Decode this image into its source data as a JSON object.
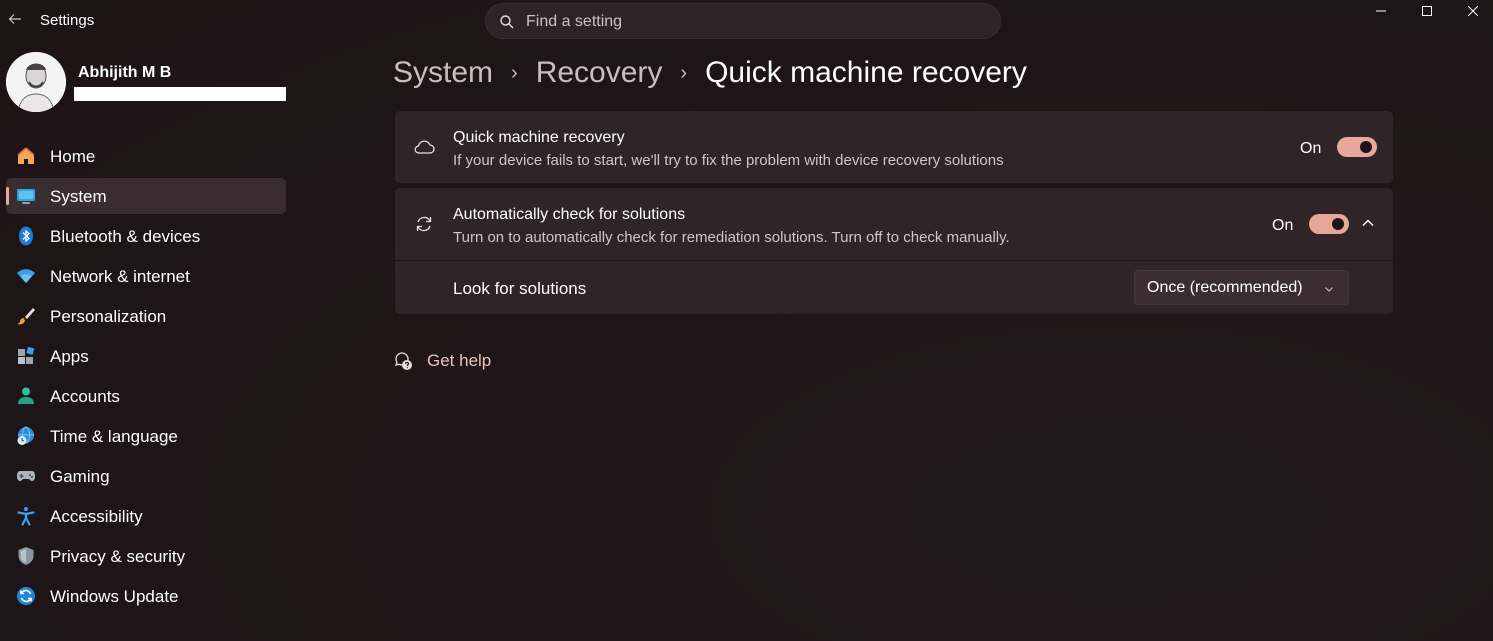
{
  "window": {
    "title": "Settings"
  },
  "search": {
    "placeholder": "Find a setting"
  },
  "user": {
    "name": "Abhijith M B"
  },
  "sidebar": {
    "items": [
      {
        "label": "Home",
        "icon": "home-icon"
      },
      {
        "label": "System",
        "icon": "system-icon",
        "selected": true
      },
      {
        "label": "Bluetooth & devices",
        "icon": "bluetooth-icon"
      },
      {
        "label": "Network & internet",
        "icon": "wifi-icon"
      },
      {
        "label": "Personalization",
        "icon": "brush-icon"
      },
      {
        "label": "Apps",
        "icon": "apps-icon"
      },
      {
        "label": "Accounts",
        "icon": "accounts-icon"
      },
      {
        "label": "Time & language",
        "icon": "globe-clock-icon"
      },
      {
        "label": "Gaming",
        "icon": "gamepad-icon"
      },
      {
        "label": "Accessibility",
        "icon": "accessibility-icon"
      },
      {
        "label": "Privacy & security",
        "icon": "shield-icon"
      },
      {
        "label": "Windows Update",
        "icon": "update-icon"
      }
    ]
  },
  "breadcrumb": {
    "items": [
      "System",
      "Recovery"
    ],
    "current": "Quick machine recovery"
  },
  "settings": {
    "quick_recovery": {
      "title": "Quick machine recovery",
      "description": "If your device fails to start, we'll try to fix the problem with device recovery solutions",
      "state": "On",
      "enabled": true
    },
    "auto_check": {
      "title": "Automatically check for solutions",
      "description": "Turn on to automatically check for remediation solutions. Turn off to check manually.",
      "state": "On",
      "enabled": true,
      "expanded": true
    },
    "look_for_solutions": {
      "label": "Look for solutions",
      "value": "Once (recommended)"
    }
  },
  "help": {
    "label": "Get help"
  },
  "colors": {
    "accent": "#e7a79b",
    "background": "#201619",
    "card": "#2f2427",
    "selected": "#3a2d31"
  }
}
